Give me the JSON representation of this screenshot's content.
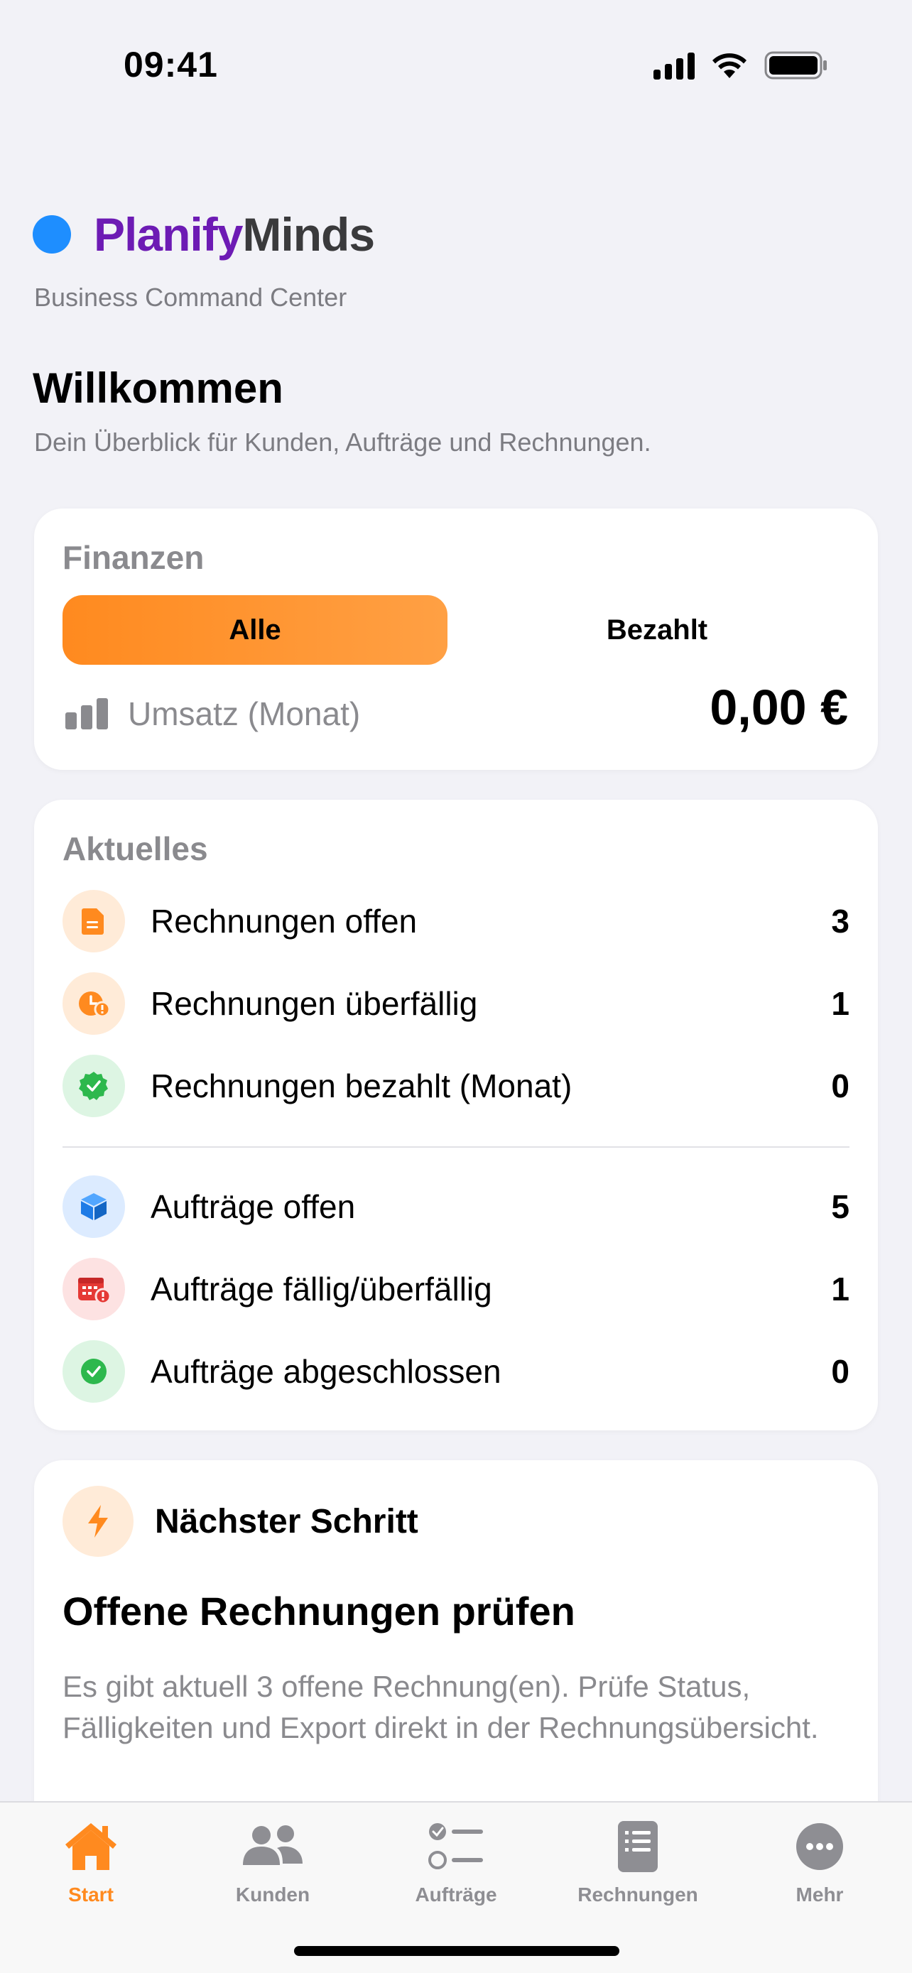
{
  "status_bar": {
    "time": "09:41"
  },
  "header": {
    "brand_part1": "Planify",
    "brand_part2": "Minds",
    "subtitle": "Business Command Center",
    "welcome": "Willkommen",
    "welcome_sub": "Dein Überblick für Kunden, Aufträge und Rechnungen."
  },
  "finance": {
    "title": "Finanzen",
    "segments": [
      "Alle",
      "Bezahlt"
    ],
    "selected_segment": "Alle",
    "revenue_label": "Umsatz (Monat)",
    "revenue_value": "0,00 €"
  },
  "news": {
    "title": "Aktuelles",
    "invoices": [
      {
        "label": "Rechnungen offen",
        "count": "3",
        "icon": "document-icon"
      },
      {
        "label": "Rechnungen überfällig",
        "count": "1",
        "icon": "clock-alert-icon"
      },
      {
        "label": "Rechnungen bezahlt (Monat)",
        "count": "0",
        "icon": "check-badge-icon"
      }
    ],
    "orders": [
      {
        "label": "Aufträge offen",
        "count": "5",
        "icon": "box-icon"
      },
      {
        "label": "Aufträge fällig/überfällig",
        "count": "1",
        "icon": "calendar-alert-icon"
      },
      {
        "label": "Aufträge abgeschlossen",
        "count": "0",
        "icon": "check-circle-icon"
      }
    ]
  },
  "next_step": {
    "heading": "Nächster Schritt",
    "title": "Offene Rechnungen prüfen",
    "text": "Es gibt aktuell 3 offene Rechnung(en). Prüfe Status, Fälligkeiten und Export direkt in der Rechnungs­übersicht."
  },
  "tabbar": {
    "tabs": [
      {
        "label": "Start",
        "icon": "house-icon",
        "active": true
      },
      {
        "label": "Kunden",
        "icon": "people-icon",
        "active": false
      },
      {
        "label": "Aufträge",
        "icon": "checklist-icon",
        "active": false
      },
      {
        "label": "Rechnungen",
        "icon": "list-doc-icon",
        "active": false
      },
      {
        "label": "Mehr",
        "icon": "more-icon",
        "active": false
      }
    ]
  },
  "colors": {
    "accent": "#FF8A1F",
    "brand_primary": "#6D1BB4",
    "brand_dot": "#1E8EFF",
    "background": "#F2F2F7"
  }
}
